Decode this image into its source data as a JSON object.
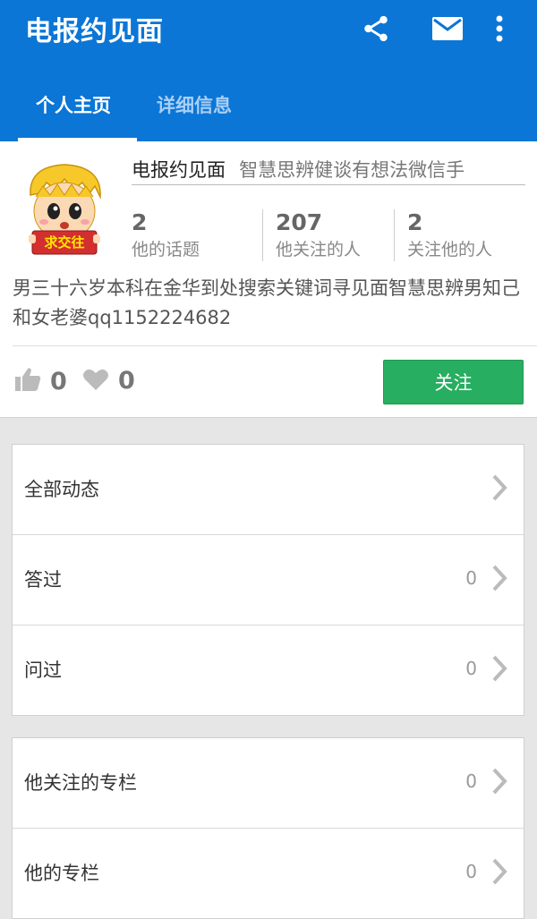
{
  "appbar": {
    "title": "电报约见面",
    "icons": [
      "share-icon",
      "mail-icon",
      "more-vert-icon"
    ]
  },
  "tabs": [
    {
      "label": "个人主页",
      "active": true
    },
    {
      "label": "详细信息",
      "active": false
    }
  ],
  "profile": {
    "name": "电报约见面",
    "motto": "智慧思辨健谈有想法微信手",
    "stats": [
      {
        "value": "2",
        "label": "他的话题"
      },
      {
        "value": "207",
        "label": "他关注的人"
      },
      {
        "value": "2",
        "label": "关注他的人"
      }
    ],
    "bio": "男三十六岁本科在金华到处搜索关键词寻见面智慧思辨男知己和女老婆qq1152224682",
    "avatar_badge": "求交往"
  },
  "actions": {
    "likes": "0",
    "favorites": "0",
    "follow_label": "关注"
  },
  "group1": [
    {
      "label": "全部动态",
      "count": ""
    },
    {
      "label": "答过",
      "count": "0"
    },
    {
      "label": "问过",
      "count": "0"
    }
  ],
  "group2": [
    {
      "label": "他关注的专栏",
      "count": "0"
    },
    {
      "label": "他的专栏",
      "count": "0"
    }
  ],
  "colors": {
    "primary": "#0b76d6",
    "follow_button": "#27ae60"
  }
}
